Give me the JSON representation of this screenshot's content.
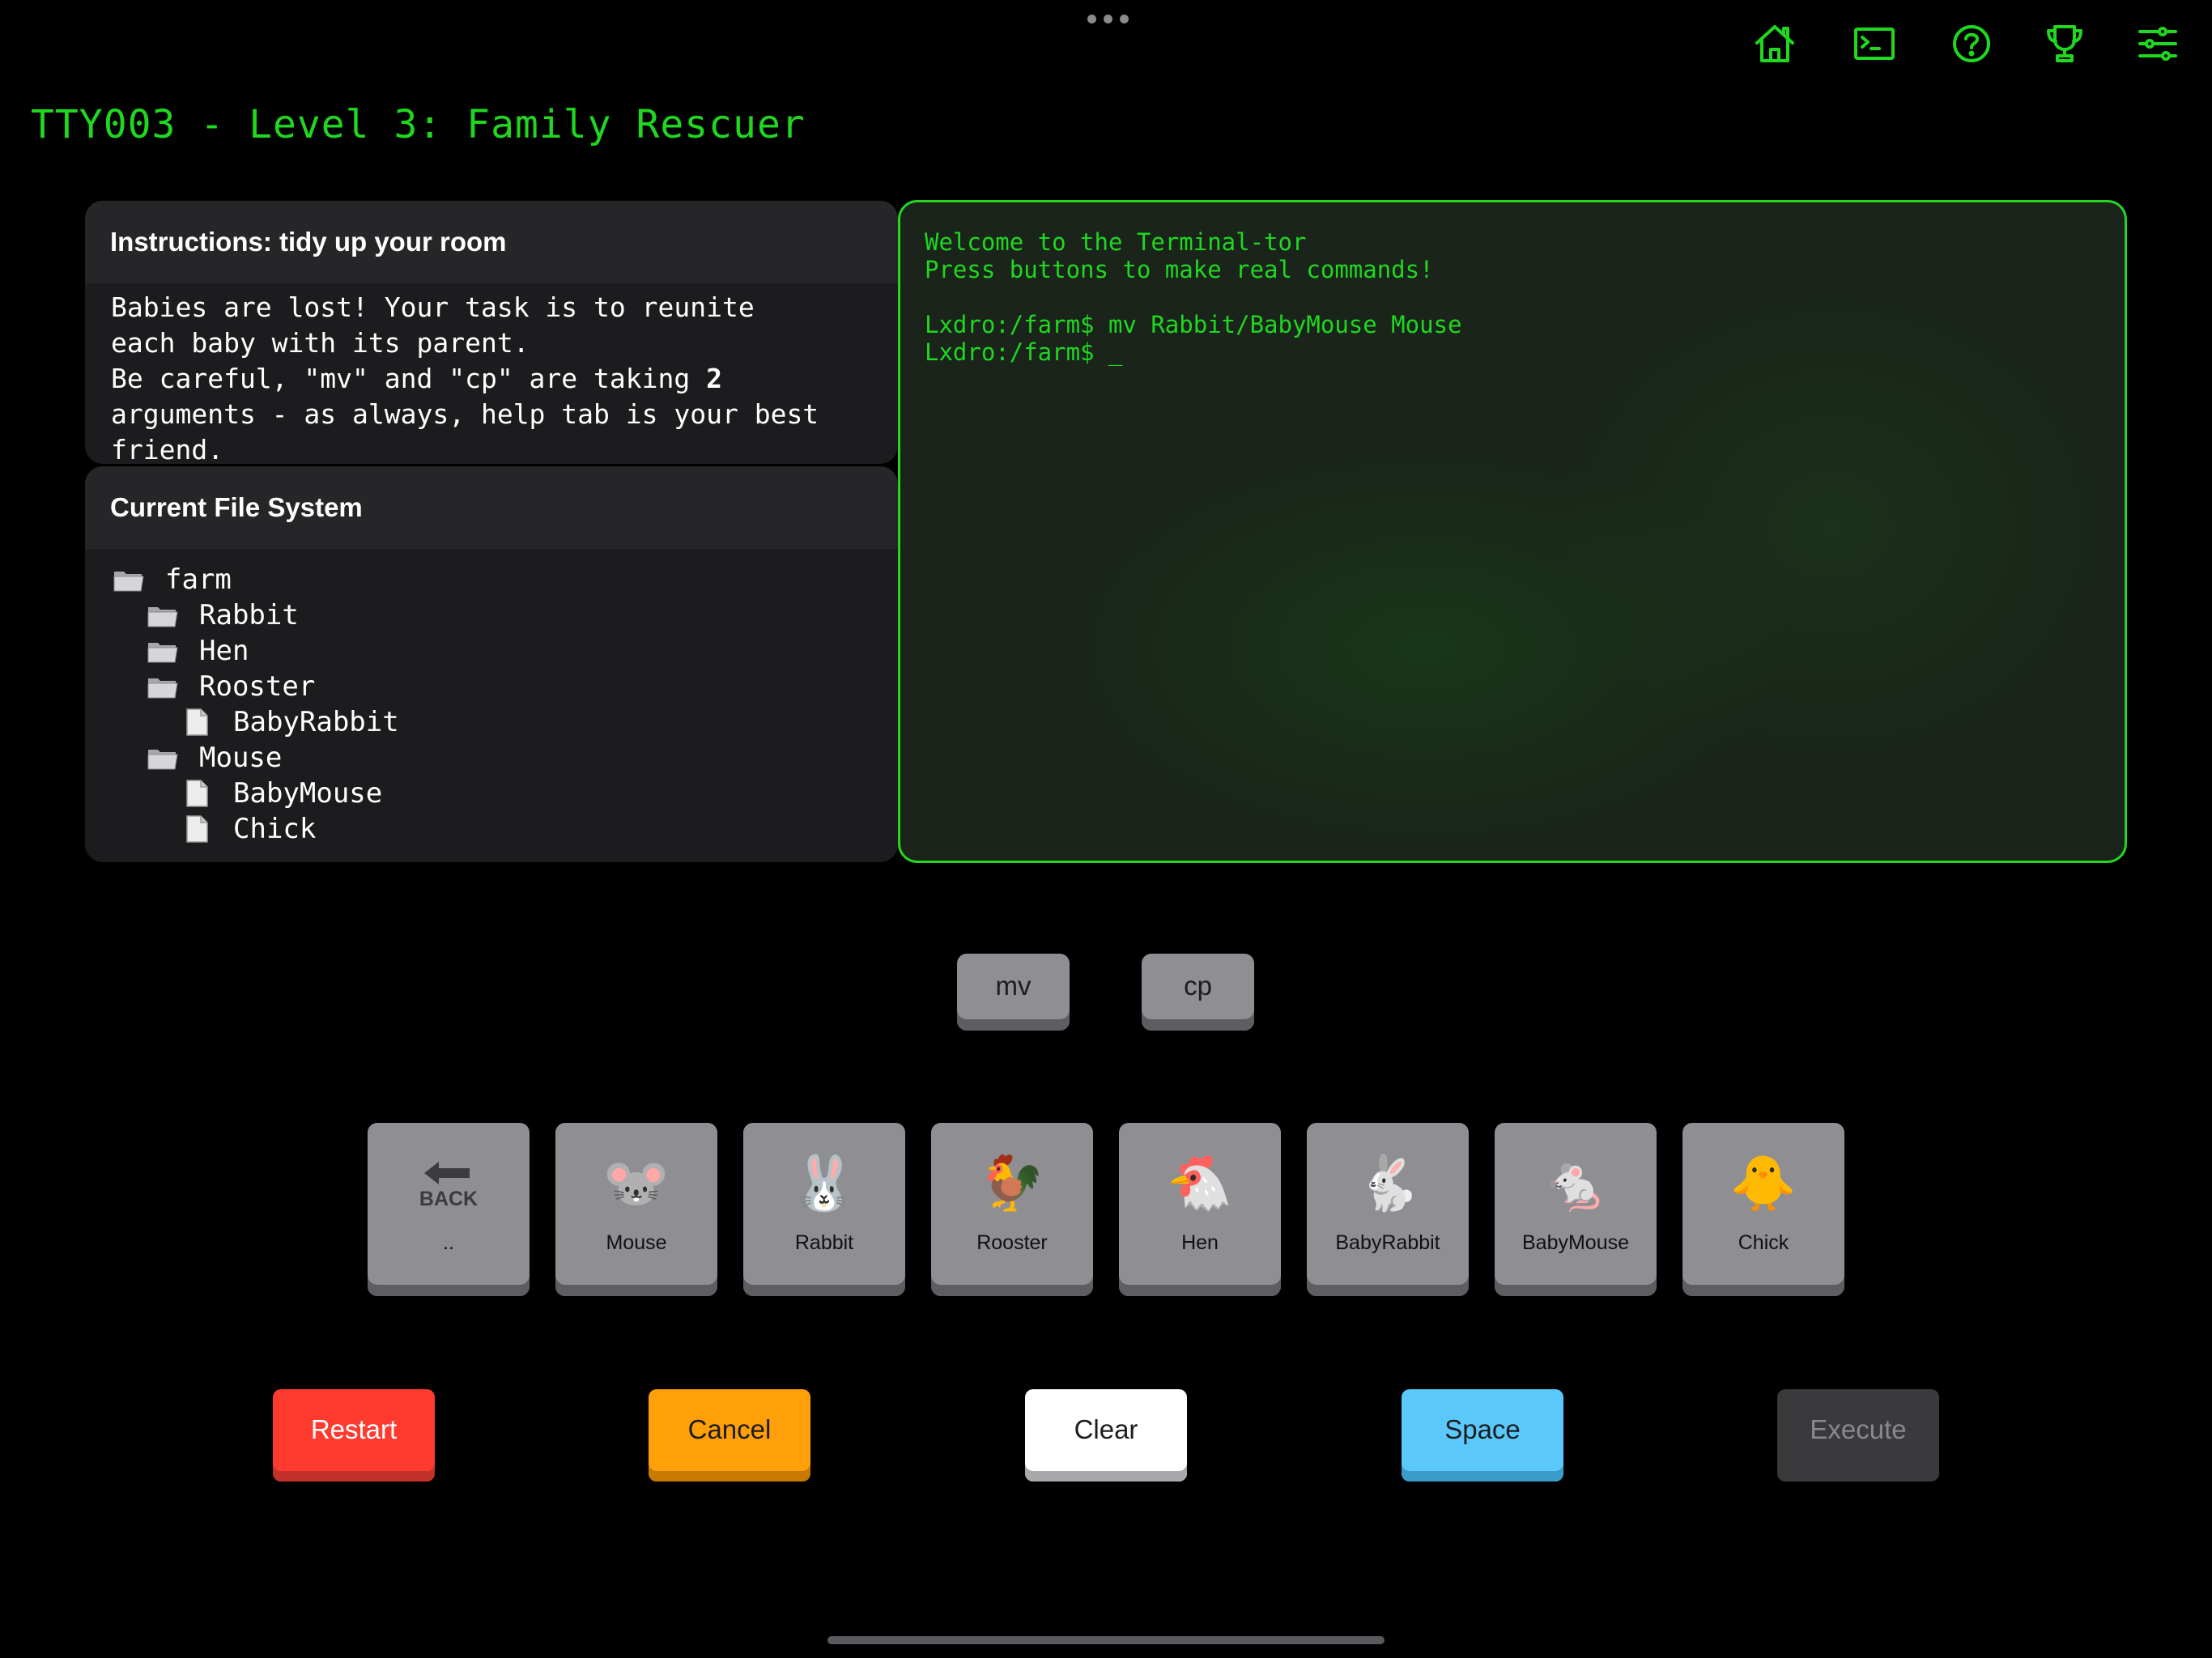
{
  "app": {
    "title": "TTY003 - Level 3: Family Rescuer"
  },
  "toolbar": {
    "icons": [
      "home-icon",
      "terminal-icon",
      "help-icon",
      "trophy-icon",
      "settings-sliders-icon"
    ],
    "accent_color": "#1fd81f"
  },
  "instructions": {
    "header": "Instructions: tidy up your room",
    "line1": "Babies are lost! Your task is to reunite",
    "line2": "each baby with its parent.",
    "line3_a": "Be careful, \"mv\" and \"cp\" are taking ",
    "line3_b": "2",
    "line4": "arguments - as always, help tab is your best",
    "line5": "friend."
  },
  "filesystem": {
    "header": "Current File System",
    "entries": [
      {
        "name": "farm",
        "type": "folder"
      },
      {
        "name": "Rabbit",
        "type": "folder"
      },
      {
        "name": "Hen",
        "type": "folder"
      },
      {
        "name": "Rooster",
        "type": "folder"
      },
      {
        "name": "BabyRabbit",
        "type": "file"
      },
      {
        "name": "Mouse",
        "type": "folder"
      },
      {
        "name": "BabyMouse",
        "type": "file"
      },
      {
        "name": "Chick",
        "type": "file"
      }
    ]
  },
  "terminal": {
    "lines": [
      "Welcome to the Terminal-tor",
      "Press buttons to make real commands!",
      "",
      "Lxdro:/farm$ mv Rabbit/BabyMouse Mouse",
      "Lxdro:/farm$ _"
    ],
    "border_color": "#22d622"
  },
  "commands": [
    {
      "label": "mv"
    },
    {
      "label": "cp"
    }
  ],
  "arguments": [
    {
      "icon": "back-arrow-icon",
      "icon_text": "BACK",
      "label": ".."
    },
    {
      "emoji": "🐭",
      "label": "Mouse"
    },
    {
      "emoji": "🐰",
      "label": "Rabbit"
    },
    {
      "emoji": "🐓",
      "label": "Rooster"
    },
    {
      "emoji": "🐔",
      "label": "Hen"
    },
    {
      "emoji": "🐇",
      "label": "BabyRabbit"
    },
    {
      "emoji": "🐁",
      "label": "BabyMouse"
    },
    {
      "emoji": "🐥",
      "label": "Chick"
    }
  ],
  "controls": {
    "restart": "Restart",
    "cancel": "Cancel",
    "clear": "Clear",
    "space": "Space",
    "execute": "Execute"
  },
  "colors": {
    "restart": "#ff3b30",
    "cancel": "#ff9f0a",
    "clear": "#ffffff",
    "space": "#5ac8fa",
    "execute_disabled": "#3a3a3c"
  }
}
